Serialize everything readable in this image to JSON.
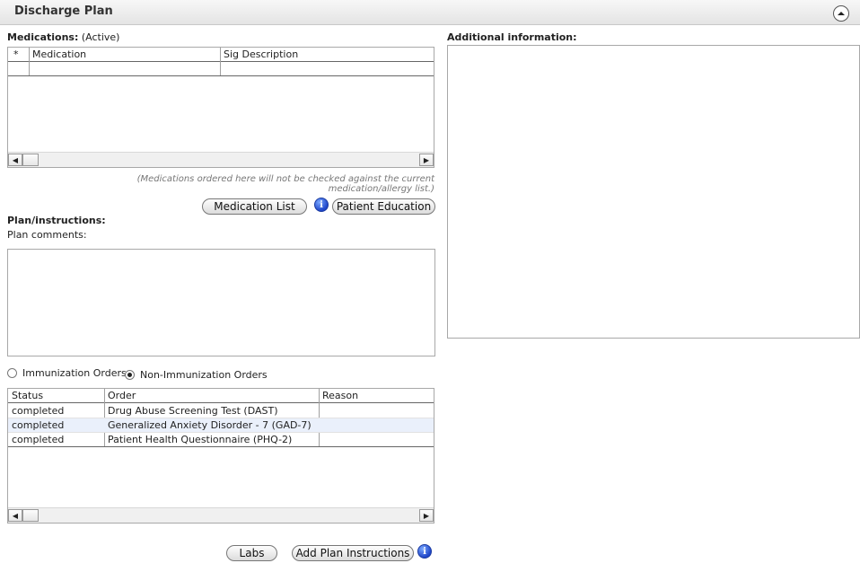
{
  "header": {
    "title": "Discharge Plan"
  },
  "medications": {
    "label": "Medications:",
    "status": "(Active)",
    "columns": [
      "*",
      "Medication",
      "Sig Description"
    ],
    "note": "(Medications ordered here will not be checked against the current medication/allergy list.)"
  },
  "buttons": {
    "medication_list": "Medication List",
    "patient_education": "Patient Education",
    "labs": "Labs",
    "add_plan_instructions": "Add Plan Instructions"
  },
  "plan": {
    "label": "Plan/instructions:",
    "comments_label": "Plan comments:",
    "comments_value": ""
  },
  "additional_info": {
    "label": "Additional information:",
    "value": ""
  },
  "order_type": {
    "immunization": "Immunization Orders",
    "non_immunization": "Non-Immunization Orders",
    "selected": "Non-Immunization Orders"
  },
  "orders": {
    "columns": [
      "Status",
      "Order",
      "Reason"
    ],
    "rows": [
      {
        "status": "completed",
        "order": "Drug Abuse Screening Test (DAST)",
        "reason": ""
      },
      {
        "status": "completed",
        "order": "Generalized Anxiety Disorder - 7 (GAD-7)",
        "reason": ""
      },
      {
        "status": "completed",
        "order": "Patient Health Questionnaire (PHQ-2)",
        "reason": ""
      }
    ]
  },
  "icons": {
    "collapse": "chevron-up-circle-icon",
    "info": "info-icon",
    "scroll_left": "arrow-left-icon",
    "scroll_right": "arrow-right-icon"
  }
}
